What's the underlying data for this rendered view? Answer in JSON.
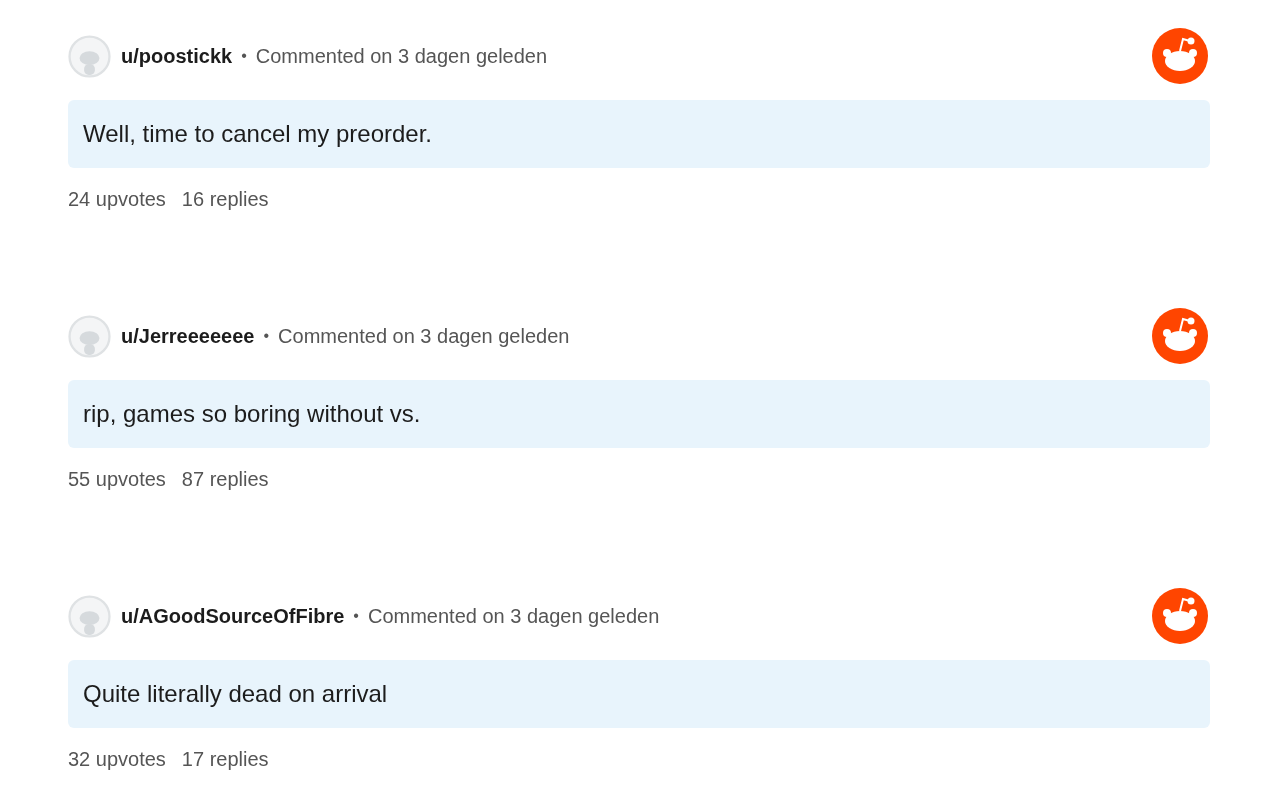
{
  "comments": [
    {
      "username": "u/poostickk",
      "separator": "•",
      "meta": "Commented on 3 dagen geleden",
      "body": "Well, time to cancel my preorder.",
      "upvotes": "24 upvotes",
      "replies": "16 replies"
    },
    {
      "username": "u/Jerreeeeeee",
      "separator": "•",
      "meta": "Commented on 3 dagen geleden",
      "body": "rip, games so boring without vs.",
      "upvotes": "55 upvotes",
      "replies": "87 replies"
    },
    {
      "username": "u/AGoodSourceOfFibre",
      "separator": "•",
      "meta": "Commented on 3 dagen geleden",
      "body": "Quite literally dead on arrival",
      "upvotes": "32 upvotes",
      "replies": "17 replies"
    }
  ]
}
